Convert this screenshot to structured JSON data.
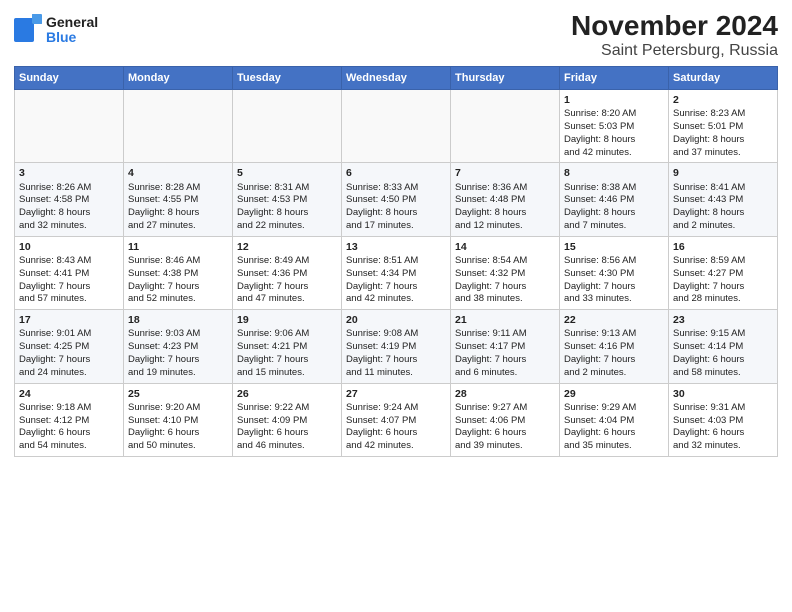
{
  "header": {
    "logo_general": "General",
    "logo_blue": "Blue",
    "title": "November 2024",
    "subtitle": "Saint Petersburg, Russia"
  },
  "weekdays": [
    "Sunday",
    "Monday",
    "Tuesday",
    "Wednesday",
    "Thursday",
    "Friday",
    "Saturday"
  ],
  "weeks": [
    [
      {
        "day": "",
        "content": ""
      },
      {
        "day": "",
        "content": ""
      },
      {
        "day": "",
        "content": ""
      },
      {
        "day": "",
        "content": ""
      },
      {
        "day": "",
        "content": ""
      },
      {
        "day": "1",
        "content": "Sunrise: 8:20 AM\nSunset: 5:03 PM\nDaylight: 8 hours\nand 42 minutes."
      },
      {
        "day": "2",
        "content": "Sunrise: 8:23 AM\nSunset: 5:01 PM\nDaylight: 8 hours\nand 37 minutes."
      }
    ],
    [
      {
        "day": "3",
        "content": "Sunrise: 8:26 AM\nSunset: 4:58 PM\nDaylight: 8 hours\nand 32 minutes."
      },
      {
        "day": "4",
        "content": "Sunrise: 8:28 AM\nSunset: 4:55 PM\nDaylight: 8 hours\nand 27 minutes."
      },
      {
        "day": "5",
        "content": "Sunrise: 8:31 AM\nSunset: 4:53 PM\nDaylight: 8 hours\nand 22 minutes."
      },
      {
        "day": "6",
        "content": "Sunrise: 8:33 AM\nSunset: 4:50 PM\nDaylight: 8 hours\nand 17 minutes."
      },
      {
        "day": "7",
        "content": "Sunrise: 8:36 AM\nSunset: 4:48 PM\nDaylight: 8 hours\nand 12 minutes."
      },
      {
        "day": "8",
        "content": "Sunrise: 8:38 AM\nSunset: 4:46 PM\nDaylight: 8 hours\nand 7 minutes."
      },
      {
        "day": "9",
        "content": "Sunrise: 8:41 AM\nSunset: 4:43 PM\nDaylight: 8 hours\nand 2 minutes."
      }
    ],
    [
      {
        "day": "10",
        "content": "Sunrise: 8:43 AM\nSunset: 4:41 PM\nDaylight: 7 hours\nand 57 minutes."
      },
      {
        "day": "11",
        "content": "Sunrise: 8:46 AM\nSunset: 4:38 PM\nDaylight: 7 hours\nand 52 minutes."
      },
      {
        "day": "12",
        "content": "Sunrise: 8:49 AM\nSunset: 4:36 PM\nDaylight: 7 hours\nand 47 minutes."
      },
      {
        "day": "13",
        "content": "Sunrise: 8:51 AM\nSunset: 4:34 PM\nDaylight: 7 hours\nand 42 minutes."
      },
      {
        "day": "14",
        "content": "Sunrise: 8:54 AM\nSunset: 4:32 PM\nDaylight: 7 hours\nand 38 minutes."
      },
      {
        "day": "15",
        "content": "Sunrise: 8:56 AM\nSunset: 4:30 PM\nDaylight: 7 hours\nand 33 minutes."
      },
      {
        "day": "16",
        "content": "Sunrise: 8:59 AM\nSunset: 4:27 PM\nDaylight: 7 hours\nand 28 minutes."
      }
    ],
    [
      {
        "day": "17",
        "content": "Sunrise: 9:01 AM\nSunset: 4:25 PM\nDaylight: 7 hours\nand 24 minutes."
      },
      {
        "day": "18",
        "content": "Sunrise: 9:03 AM\nSunset: 4:23 PM\nDaylight: 7 hours\nand 19 minutes."
      },
      {
        "day": "19",
        "content": "Sunrise: 9:06 AM\nSunset: 4:21 PM\nDaylight: 7 hours\nand 15 minutes."
      },
      {
        "day": "20",
        "content": "Sunrise: 9:08 AM\nSunset: 4:19 PM\nDaylight: 7 hours\nand 11 minutes."
      },
      {
        "day": "21",
        "content": "Sunrise: 9:11 AM\nSunset: 4:17 PM\nDaylight: 7 hours\nand 6 minutes."
      },
      {
        "day": "22",
        "content": "Sunrise: 9:13 AM\nSunset: 4:16 PM\nDaylight: 7 hours\nand 2 minutes."
      },
      {
        "day": "23",
        "content": "Sunrise: 9:15 AM\nSunset: 4:14 PM\nDaylight: 6 hours\nand 58 minutes."
      }
    ],
    [
      {
        "day": "24",
        "content": "Sunrise: 9:18 AM\nSunset: 4:12 PM\nDaylight: 6 hours\nand 54 minutes."
      },
      {
        "day": "25",
        "content": "Sunrise: 9:20 AM\nSunset: 4:10 PM\nDaylight: 6 hours\nand 50 minutes."
      },
      {
        "day": "26",
        "content": "Sunrise: 9:22 AM\nSunset: 4:09 PM\nDaylight: 6 hours\nand 46 minutes."
      },
      {
        "day": "27",
        "content": "Sunrise: 9:24 AM\nSunset: 4:07 PM\nDaylight: 6 hours\nand 42 minutes."
      },
      {
        "day": "28",
        "content": "Sunrise: 9:27 AM\nSunset: 4:06 PM\nDaylight: 6 hours\nand 39 minutes."
      },
      {
        "day": "29",
        "content": "Sunrise: 9:29 AM\nSunset: 4:04 PM\nDaylight: 6 hours\nand 35 minutes."
      },
      {
        "day": "30",
        "content": "Sunrise: 9:31 AM\nSunset: 4:03 PM\nDaylight: 6 hours\nand 32 minutes."
      }
    ]
  ]
}
